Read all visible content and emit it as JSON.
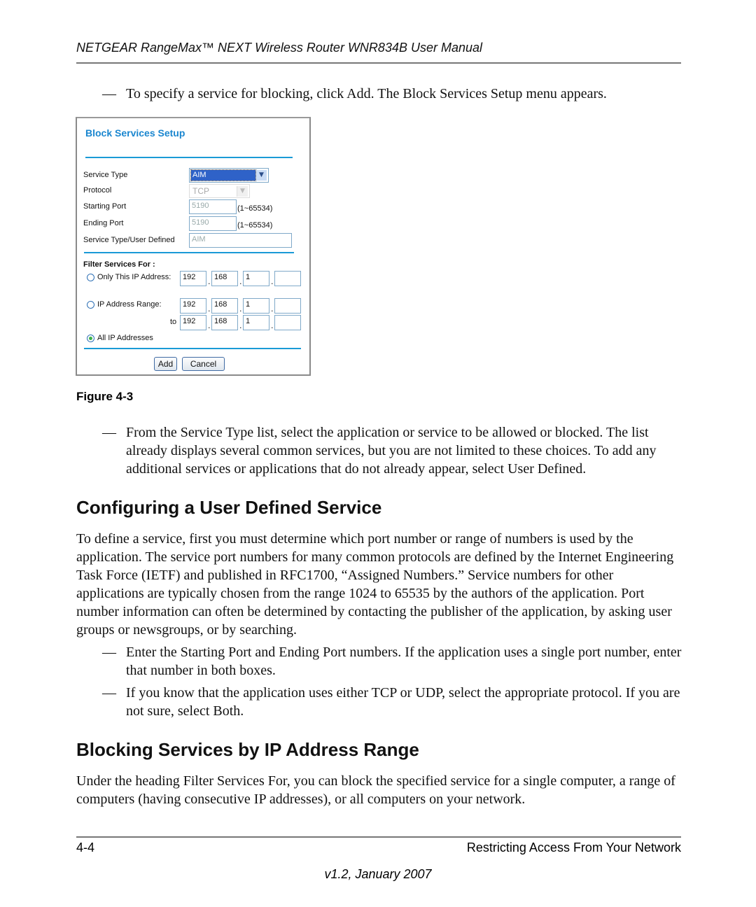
{
  "header": {
    "title": "NETGEAR RangeMax™ NEXT Wireless Router WNR834B User Manual"
  },
  "intro_bullet": "To specify a service for blocking, click Add. The Block Services Setup menu appears.",
  "figure": {
    "caption": "Figure 4-3",
    "screen": {
      "title": "Block Services Setup",
      "service_type_label": "Service Type",
      "service_type_value": "AIM",
      "protocol_label": "Protocol",
      "protocol_value": "TCP",
      "starting_port_label": "Starting Port",
      "starting_port_value": "5190",
      "ending_port_label": "Ending Port",
      "ending_port_value": "5190",
      "port_range_hint": "(1~65534)",
      "user_defined_label": "Service Type/User Defined",
      "user_defined_value": "AIM",
      "filter_heading": "Filter Services For :",
      "only_ip_label": "Only This IP Address:",
      "ip_range_label": "IP Address Range:",
      "to_label": "to",
      "all_ip_label": "All IP Addresses",
      "selected_option": "All IP Addresses",
      "only_ip": [
        "192",
        "168",
        "1",
        ""
      ],
      "range_from": [
        "192",
        "168",
        "1",
        ""
      ],
      "range_to": [
        "192",
        "168",
        "1",
        ""
      ],
      "add_label": "Add",
      "cancel_label": "Cancel"
    }
  },
  "bullet_service_type": "From the Service Type list, select the application or service to be allowed or blocked. The list already displays several common services, but you are not limited to these choices. To add any additional services or applications that do not already appear, select User Defined.",
  "section1": {
    "heading": "Configuring a User Defined Service",
    "paragraph": "To define a service, first you must determine which port number or range of numbers is used by the application. The service port numbers for many common protocols are defined by the Internet Engineering Task Force (IETF) and published in RFC1700, “Assigned Numbers.” Service numbers for other applications are typically chosen from the range 1024 to 65535 by the authors of the application. Port number information can often be determined by contacting the publisher of the application, by asking user groups or newsgroups, or by searching.",
    "bullets": [
      "Enter the Starting Port and Ending Port numbers. If the application uses a single port number, enter that number in both boxes.",
      "If you know that the application uses either TCP or UDP, select the appropriate protocol. If you are not sure, select Both."
    ]
  },
  "section2": {
    "heading": "Blocking Services by IP Address Range",
    "paragraph": "Under the heading Filter Services For, you can block the specified service for a single computer, a range of computers (having consecutive IP addresses), or all computers on your network."
  },
  "footer": {
    "page_number": "4-4",
    "chapter": "Restricting Access From Your Network",
    "version": "v1.2, January 2007"
  },
  "dash": "—"
}
